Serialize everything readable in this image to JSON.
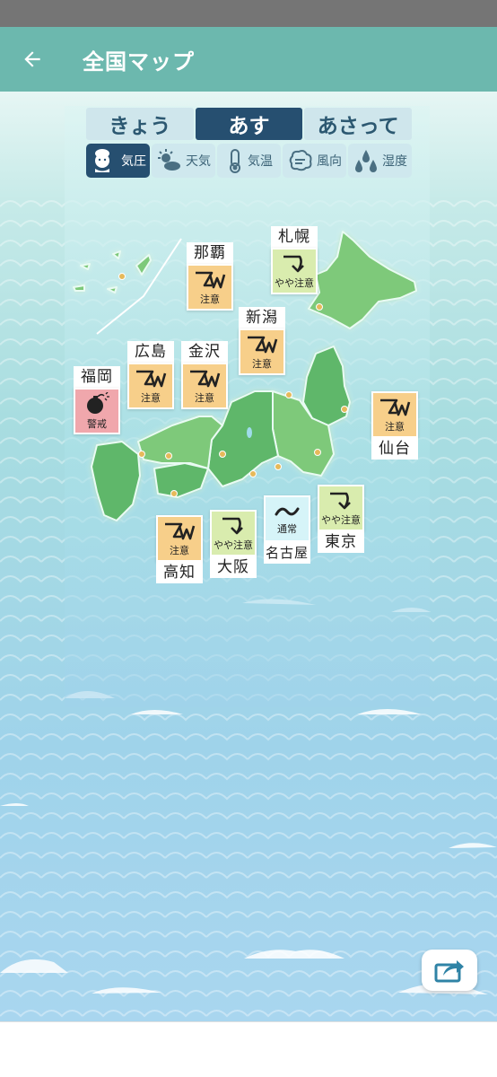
{
  "header": {
    "title": "全国マップ",
    "back_icon": "arrow-left-icon"
  },
  "day_tabs": [
    {
      "label": "きょう",
      "active": false
    },
    {
      "label": "あす",
      "active": true
    },
    {
      "label": "あさって",
      "active": false
    }
  ],
  "type_tabs": [
    {
      "label": "気圧",
      "icon": "pressure-character-icon",
      "active": true
    },
    {
      "label": "天気",
      "icon": "sun-cloud-icon",
      "active": false
    },
    {
      "label": "気温",
      "icon": "thermometer-icon",
      "active": false
    },
    {
      "label": "風向",
      "icon": "wind-icon",
      "active": false
    },
    {
      "label": "湿度",
      "icon": "water-drops-icon",
      "active": false
    }
  ],
  "cities": [
    {
      "name": "那覇",
      "level": "注意",
      "icon": "caution-pressure-icon"
    },
    {
      "name": "札幌",
      "level": "やや注意",
      "icon": "slight-caution-pressure-icon"
    },
    {
      "name": "新潟",
      "level": "注意",
      "icon": "caution-pressure-icon"
    },
    {
      "name": "広島",
      "level": "注意",
      "icon": "caution-pressure-icon"
    },
    {
      "name": "金沢",
      "level": "注意",
      "icon": "caution-pressure-icon"
    },
    {
      "name": "福岡",
      "level": "警戒",
      "icon": "bomb-icon"
    },
    {
      "name": "仙台",
      "level": "注意",
      "icon": "caution-pressure-icon"
    },
    {
      "name": "名古屋",
      "level": "通常",
      "icon": "tilde-icon"
    },
    {
      "name": "東京",
      "level": "やや注意",
      "icon": "slight-caution-pressure-icon"
    },
    {
      "name": "大阪",
      "level": "やや注意",
      "icon": "slight-caution-pressure-icon"
    },
    {
      "name": "高知",
      "level": "注意",
      "icon": "caution-pressure-icon"
    }
  ],
  "colors": {
    "app_bar": "#6cb8ae",
    "active_tab": "#264f70",
    "caution": "#f7cf8a",
    "slight_caution": "#d9ecae",
    "normal": "#d6f4f8",
    "warning": "#f0a7ac",
    "land": "#6cbf6c"
  },
  "share_icon": "share-icon"
}
